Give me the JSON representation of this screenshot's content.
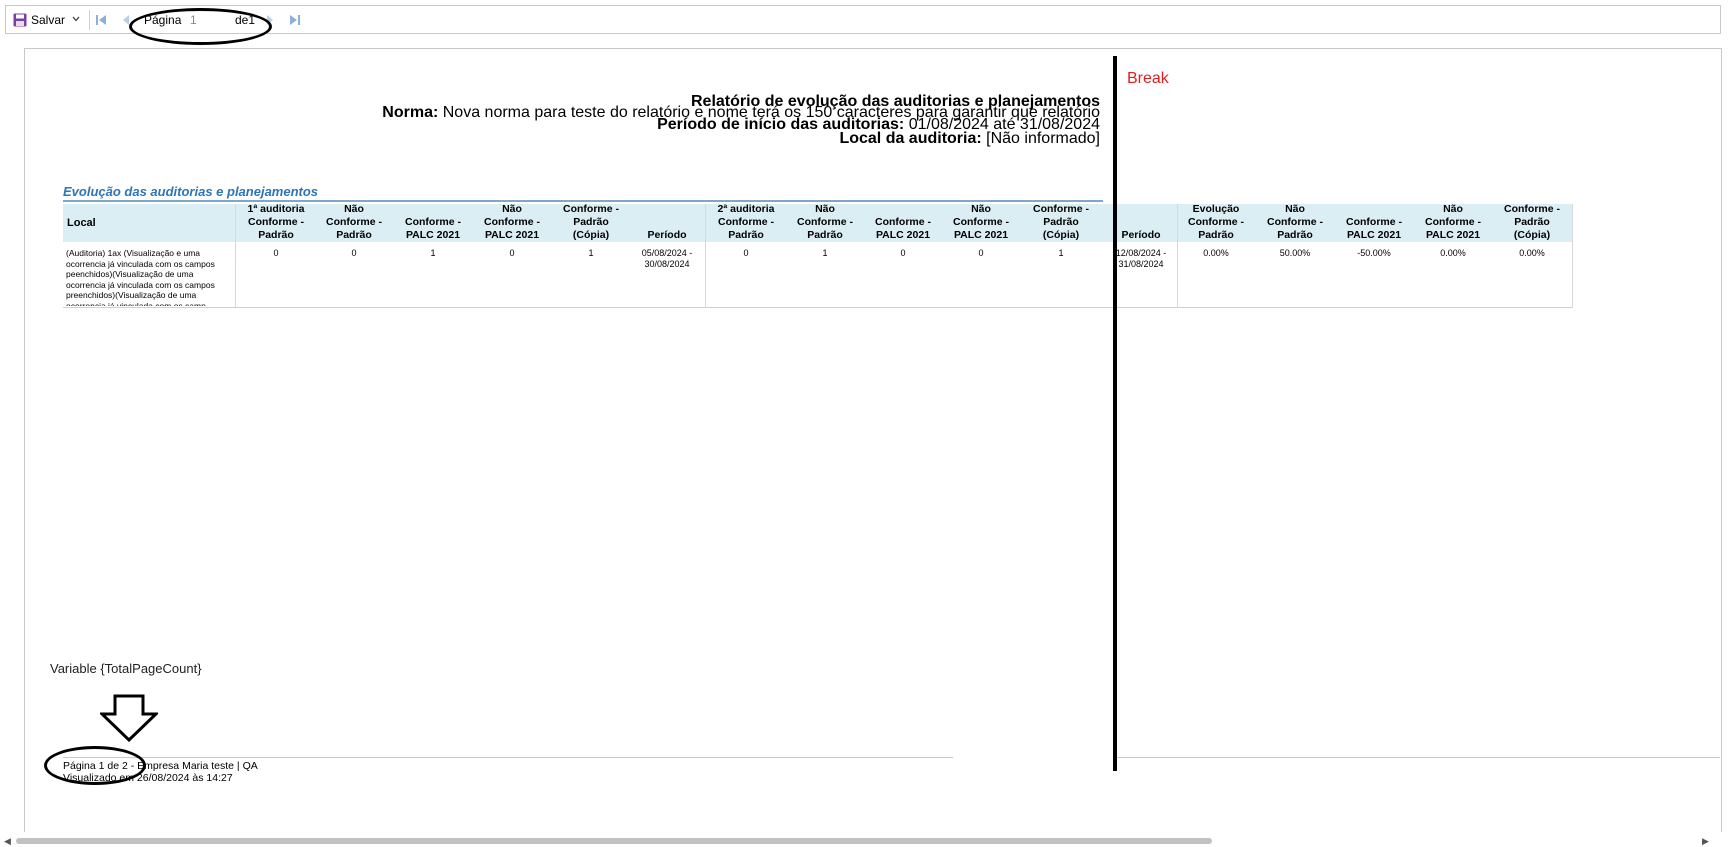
{
  "toolbar": {
    "save_label": "Salvar",
    "page_label": "Página",
    "page_value": "1",
    "page_of": "de1"
  },
  "report": {
    "title": "Relatório de evolução das auditorias e planejamentos",
    "norma_label": "Norma:",
    "norma_value": "Nova norma para teste do relatório e nome terá os 150 caracteres para garantir que relatório",
    "periodo_label": "Período de início das auditorias:",
    "periodo_value": "01/08/2024 até 31/08/2024",
    "local_label": "Local da auditoria:",
    "local_value": "[Não informado]",
    "section_title": "Evolução das auditorias e planejamentos"
  },
  "table": {
    "headers": [
      "Local",
      "1ª auditoria Conforme - Padrão",
      "Não Conforme - Padrão",
      "Conforme - PALC 2021",
      "Não Conforme - PALC 2021",
      "Conforme - Padrão (Cópia)",
      "Período",
      "2ª auditoria Conforme - Padrão",
      "Não Conforme - Padrão",
      "Conforme - PALC 2021",
      "Não Conforme - PALC 2021",
      "Conforme - Padrão (Cópia)",
      "Período",
      "Evolução Conforme - Padrão",
      "Não Conforme - Padrão",
      "Conforme - PALC 2021",
      "Não Conforme - PALC 2021",
      "Conforme - Padrão (Cópia)"
    ],
    "row": [
      "(Auditoria) 1ax (Visualização e uma ocorrencia já vinculada com os campos peenchidos)(Visualização de uma ocorrencia já vinculada com os campos preenchidos)(Visualização de uma ocorrencia já vinculada com os camp",
      "0",
      "0",
      "1",
      "0",
      "1",
      "05/08/2024 - 30/08/2024",
      "0",
      "1",
      "0",
      "0",
      "1",
      "12/08/2024 - 31/08/2024",
      "0.00%",
      "50.00%",
      "-50.00%",
      "0.00%",
      "0.00%"
    ]
  },
  "annotations": {
    "break_label": "Break",
    "variable_label": "Variable {TotalPageCount}"
  },
  "footer": {
    "line1": "Página 1 de 2 - Empresa Maria teste | QA",
    "line2": "Visualizado em 26/08/2024 às 14:27"
  },
  "colors": {
    "header_bg": "#daeef3",
    "section_title": "#2e75b6",
    "break_label": "#e02020"
  }
}
